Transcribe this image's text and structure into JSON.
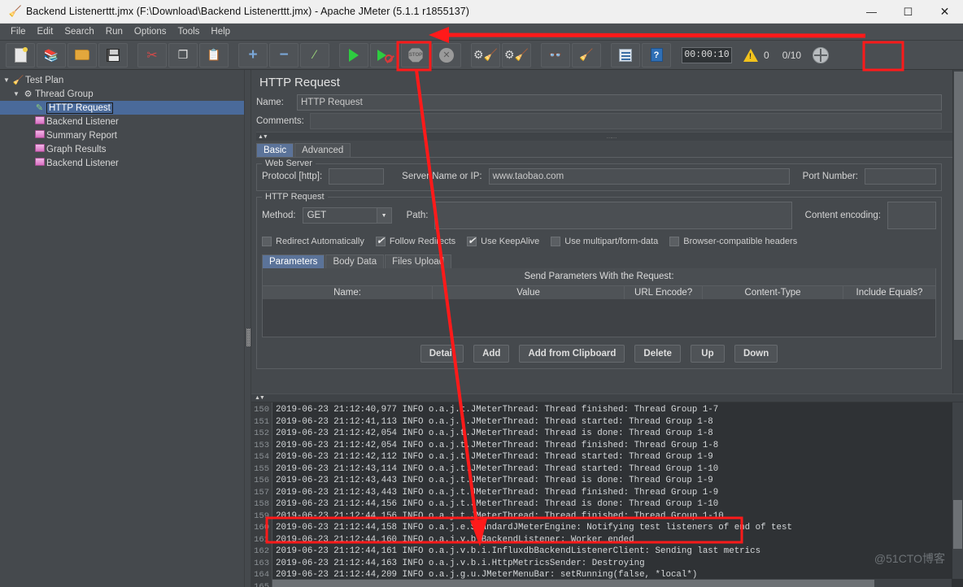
{
  "window": {
    "title": "Backend Listenerttt.jmx (F:\\Download\\Backend Listenerttt.jmx) - Apache JMeter (5.1.1 r1855137)",
    "app_icon": "jmeter-feather-icon",
    "minimize": "—",
    "maximize": "☐",
    "close": "✕"
  },
  "menubar": {
    "items": [
      {
        "label": "File"
      },
      {
        "label": "Edit"
      },
      {
        "label": "Search"
      },
      {
        "label": "Run"
      },
      {
        "label": "Options"
      },
      {
        "label": "Tools"
      },
      {
        "label": "Help"
      }
    ]
  },
  "toolbar": {
    "buttons": [
      {
        "name": "new-test-plan",
        "icon": "new-document-icon",
        "glyph": ""
      },
      {
        "name": "templates",
        "icon": "templates-icon",
        "glyph": "📚"
      },
      {
        "name": "open",
        "icon": "open-folder-icon",
        "glyph": ""
      },
      {
        "name": "save",
        "icon": "save-disk-icon",
        "glyph": ""
      },
      {
        "name": "cut",
        "icon": "scissors-icon",
        "glyph": "✂"
      },
      {
        "name": "copy",
        "icon": "copy-icon",
        "glyph": "❐"
      },
      {
        "name": "paste",
        "icon": "clipboard-icon",
        "glyph": "📋"
      },
      {
        "name": "expand-all",
        "icon": "plus-icon",
        "glyph": "+"
      },
      {
        "name": "collapse-all",
        "icon": "minus-icon",
        "glyph": "−"
      },
      {
        "name": "toggle",
        "icon": "toggle-pencil-icon",
        "glyph": "╱"
      },
      {
        "name": "start",
        "icon": "play-icon",
        "glyph": ""
      },
      {
        "name": "start-no-pauses",
        "icon": "play-no-pauses-icon",
        "glyph": ""
      },
      {
        "name": "stop",
        "icon": "stop-icon",
        "glyph": "STOP"
      },
      {
        "name": "shutdown",
        "icon": "shutdown-icon",
        "glyph": "✕"
      },
      {
        "name": "clear",
        "icon": "gear-brush-icon",
        "glyph": "🧹"
      },
      {
        "name": "clear-all",
        "icon": "gear-brush-all-icon",
        "glyph": "🧹"
      },
      {
        "name": "search",
        "icon": "binoculars-icon",
        "glyph": "🔍"
      },
      {
        "name": "reset-search",
        "icon": "broom-icon",
        "glyph": "🧹"
      },
      {
        "name": "function-helper",
        "icon": "list-icon",
        "glyph": ""
      },
      {
        "name": "help",
        "icon": "help-book-icon",
        "glyph": "?"
      }
    ],
    "timer": "00:00:10",
    "warning_count": "0",
    "thread_count": "0/10",
    "globe_icon": "globe-icon"
  },
  "tree": {
    "items": [
      {
        "label": "Test Plan",
        "icon": "test-plan-icon",
        "depth": 0,
        "twisty": "▼",
        "selected": false
      },
      {
        "label": "Thread Group",
        "icon": "thread-group-icon",
        "depth": 1,
        "twisty": "▼",
        "selected": false
      },
      {
        "label": "HTTP Request",
        "icon": "http-request-icon",
        "depth": 2,
        "twisty": "",
        "selected": true
      },
      {
        "label": "Backend Listener",
        "icon": "listener-icon",
        "depth": 2,
        "twisty": "",
        "selected": false
      },
      {
        "label": "Summary Report",
        "icon": "listener-icon",
        "depth": 2,
        "twisty": "",
        "selected": false
      },
      {
        "label": "Graph Results",
        "icon": "listener-icon",
        "depth": 2,
        "twisty": "",
        "selected": false
      },
      {
        "label": "Backend Listener",
        "icon": "listener-icon",
        "depth": 2,
        "twisty": "",
        "selected": false
      }
    ]
  },
  "form": {
    "title": "HTTP Request",
    "name_label": "Name:",
    "name_value": "HTTP Request",
    "comments_label": "Comments:",
    "comments_value": "",
    "tabs": [
      {
        "label": "Basic",
        "active": true
      },
      {
        "label": "Advanced",
        "active": false
      }
    ],
    "web_server": {
      "legend": "Web Server",
      "protocol_label": "Protocol [http]:",
      "protocol_value": "",
      "server_label": "Server Name or IP:",
      "server_value": "www.taobao.com",
      "port_label": "Port Number:",
      "port_value": ""
    },
    "http_request": {
      "legend": "HTTP Request",
      "method_label": "Method:",
      "method_value": "GET",
      "path_label": "Path:",
      "path_value": "",
      "content_encoding_label": "Content encoding:",
      "content_encoding_value": "",
      "checkboxes": [
        {
          "label": "Redirect Automatically",
          "checked": false
        },
        {
          "label": "Follow Redirects",
          "checked": true
        },
        {
          "label": "Use KeepAlive",
          "checked": true
        },
        {
          "label": "Use multipart/form-data",
          "checked": false
        },
        {
          "label": "Browser-compatible headers",
          "checked": false
        }
      ],
      "sub_tabs": [
        {
          "label": "Parameters",
          "active": true
        },
        {
          "label": "Body Data",
          "active": false
        },
        {
          "label": "Files Upload",
          "active": false
        }
      ],
      "params_caption": "Send Parameters With the Request:",
      "params_columns": [
        "Name:",
        "Value",
        "URL Encode?",
        "Content-Type",
        "Include Equals?"
      ],
      "params_rows": [],
      "buttons": [
        "Detail",
        "Add",
        "Add from Clipboard",
        "Delete",
        "Up",
        "Down"
      ]
    }
  },
  "console": {
    "lines": [
      {
        "no": "150",
        "text": "2019-06-23 21:12:40,977 INFO o.a.j.t.JMeterThread: Thread finished: Thread Group 1-7"
      },
      {
        "no": "151",
        "text": "2019-06-23 21:12:41,113 INFO o.a.j.t.JMeterThread: Thread started: Thread Group 1-8"
      },
      {
        "no": "152",
        "text": "2019-06-23 21:12:42,054 INFO o.a.j.t.JMeterThread: Thread is done: Thread Group 1-8"
      },
      {
        "no": "153",
        "text": "2019-06-23 21:12:42,054 INFO o.a.j.t.JMeterThread: Thread finished: Thread Group 1-8"
      },
      {
        "no": "154",
        "text": "2019-06-23 21:12:42,112 INFO o.a.j.t.JMeterThread: Thread started: Thread Group 1-9"
      },
      {
        "no": "155",
        "text": "2019-06-23 21:12:43,114 INFO o.a.j.t.JMeterThread: Thread started: Thread Group 1-10"
      },
      {
        "no": "156",
        "text": "2019-06-23 21:12:43,443 INFO o.a.j.t.JMeterThread: Thread is done: Thread Group 1-9"
      },
      {
        "no": "157",
        "text": "2019-06-23 21:12:43,443 INFO o.a.j.t.JMeterThread: Thread finished: Thread Group 1-9"
      },
      {
        "no": "158",
        "text": "2019-06-23 21:12:44,156 INFO o.a.j.t.JMeterThread: Thread is done: Thread Group 1-10"
      },
      {
        "no": "159",
        "text": "2019-06-23 21:12:44,156 INFO o.a.j.t.JMeterThread: Thread finished: Thread Group 1-10"
      },
      {
        "no": "160",
        "text": "2019-06-23 21:12:44,158 INFO o.a.j.e.StandardJMeterEngine: Notifying test listeners of end of test"
      },
      {
        "no": "161",
        "text": "2019-06-23 21:12:44,160 INFO o.a.j.v.b.BackendListener: Worker ended"
      },
      {
        "no": "162",
        "text": "2019-06-23 21:12:44,161 INFO o.a.j.v.b.i.InfluxdbBackendListenerClient: Sending last metrics"
      },
      {
        "no": "163",
        "text": "2019-06-23 21:12:44,163 INFO o.a.j.v.b.i.HttpMetricsSender: Destroying"
      },
      {
        "no": "164",
        "text": "2019-06-23 21:12:44,209 INFO o.a.j.g.u.JMeterMenuBar: setRunning(false, *local*)"
      },
      {
        "no": "165",
        "text": ""
      }
    ],
    "watermark": "@51CTO博客"
  },
  "annotations": {
    "accent_color": "#ff1a1a",
    "highlight_start_button": true,
    "highlight_warning_area": true,
    "highlight_log_lines": "161-162"
  }
}
